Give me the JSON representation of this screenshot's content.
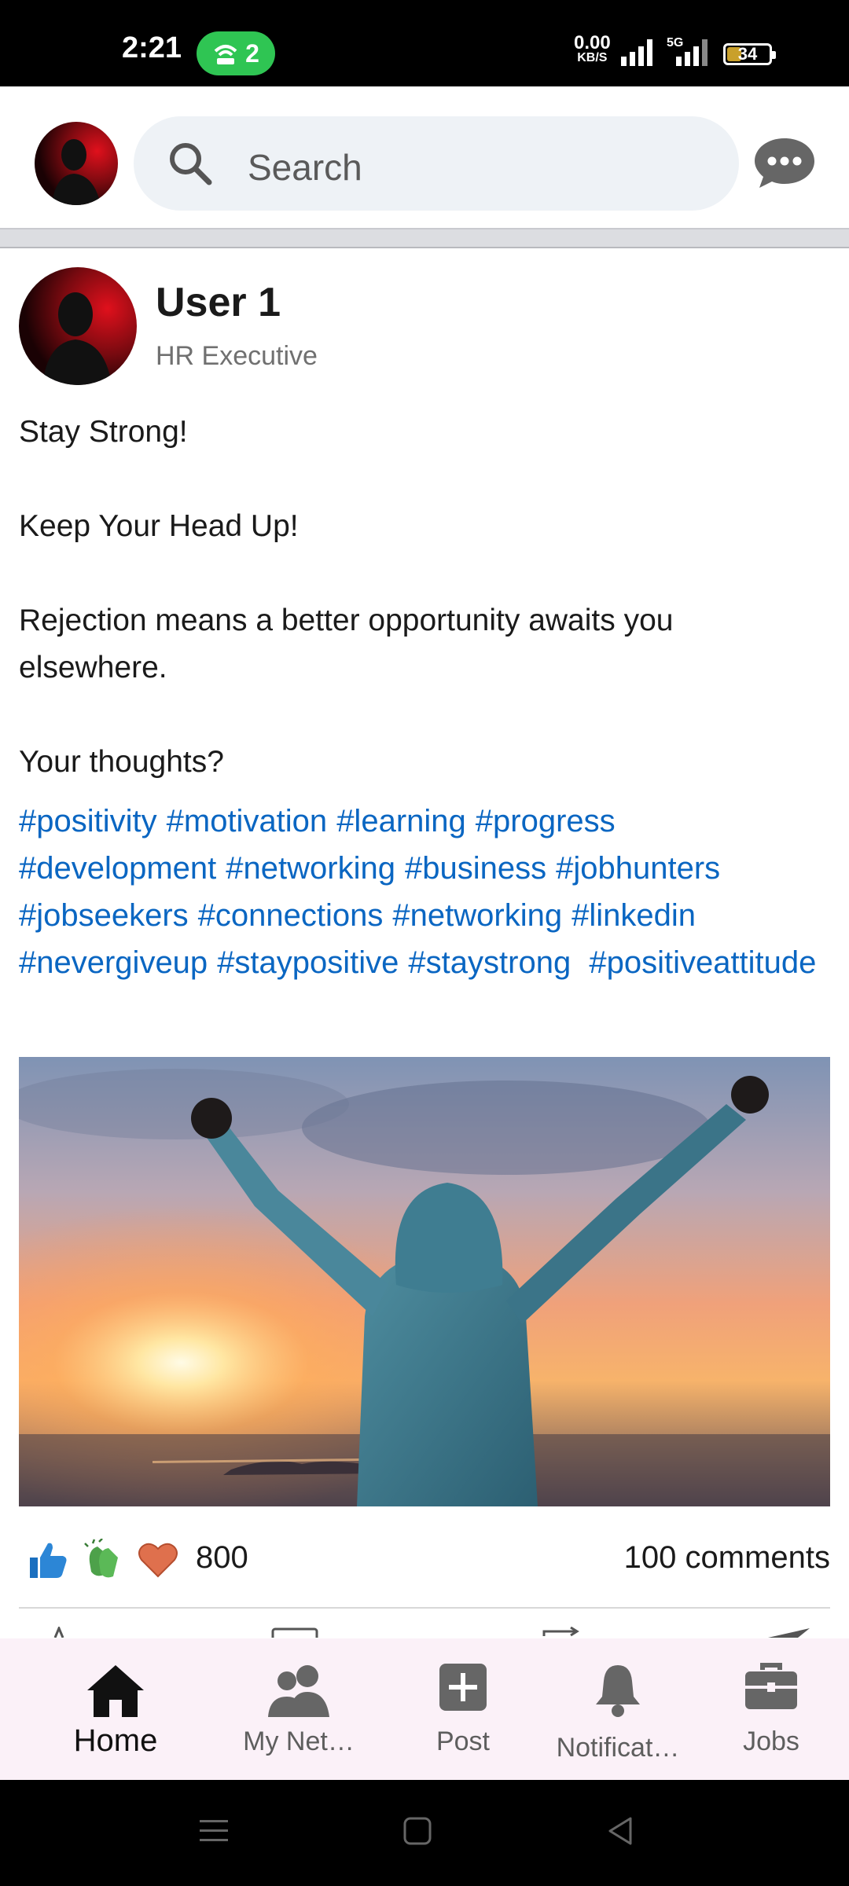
{
  "status_bar": {
    "time": "2:21",
    "hotspot_count": "2",
    "net_speed_value": "0.00",
    "net_speed_unit": "KB/S",
    "network_type": "5G",
    "battery_level": "34"
  },
  "app_bar": {
    "search_placeholder": "Search"
  },
  "post": {
    "author_name": "User 1",
    "author_role": "HR Executive",
    "body_lines": [
      "Stay Strong!",
      "",
      "Keep Your Head Up!",
      "",
      "Rejection means a better opportunity awaits you elsewhere.",
      "",
      "Your thoughts?"
    ],
    "hashtags": [
      "#positivity",
      "#motivation",
      "#learning",
      "#progress",
      "#development",
      "#networking",
      "#business",
      "#jobhunters",
      "#jobseekers",
      "#connections",
      "#networking",
      "#linkedin",
      "#nevergiveup",
      "#staypositive",
      "#staystrong",
      "#positiveattitude"
    ],
    "reaction_count": "800",
    "comments_count": "100 comments",
    "reaction_icons": [
      "like-icon",
      "clap-icon",
      "heart-icon"
    ]
  },
  "bottom_nav": {
    "items": [
      {
        "label": "Home",
        "icon": "home-icon",
        "active": true
      },
      {
        "label": "My Net…",
        "icon": "network-icon",
        "active": false
      },
      {
        "label": "Post",
        "icon": "add-post-icon",
        "active": false
      },
      {
        "label": "Notificat…",
        "icon": "bell-icon",
        "active": false
      },
      {
        "label": "Jobs",
        "icon": "briefcase-icon",
        "active": false
      }
    ]
  },
  "colors": {
    "hashtag": "#0a66c2",
    "nav_background": "#fbf1f8",
    "search_background": "#eef2f6",
    "hotspot_pill": "#2fc553"
  }
}
